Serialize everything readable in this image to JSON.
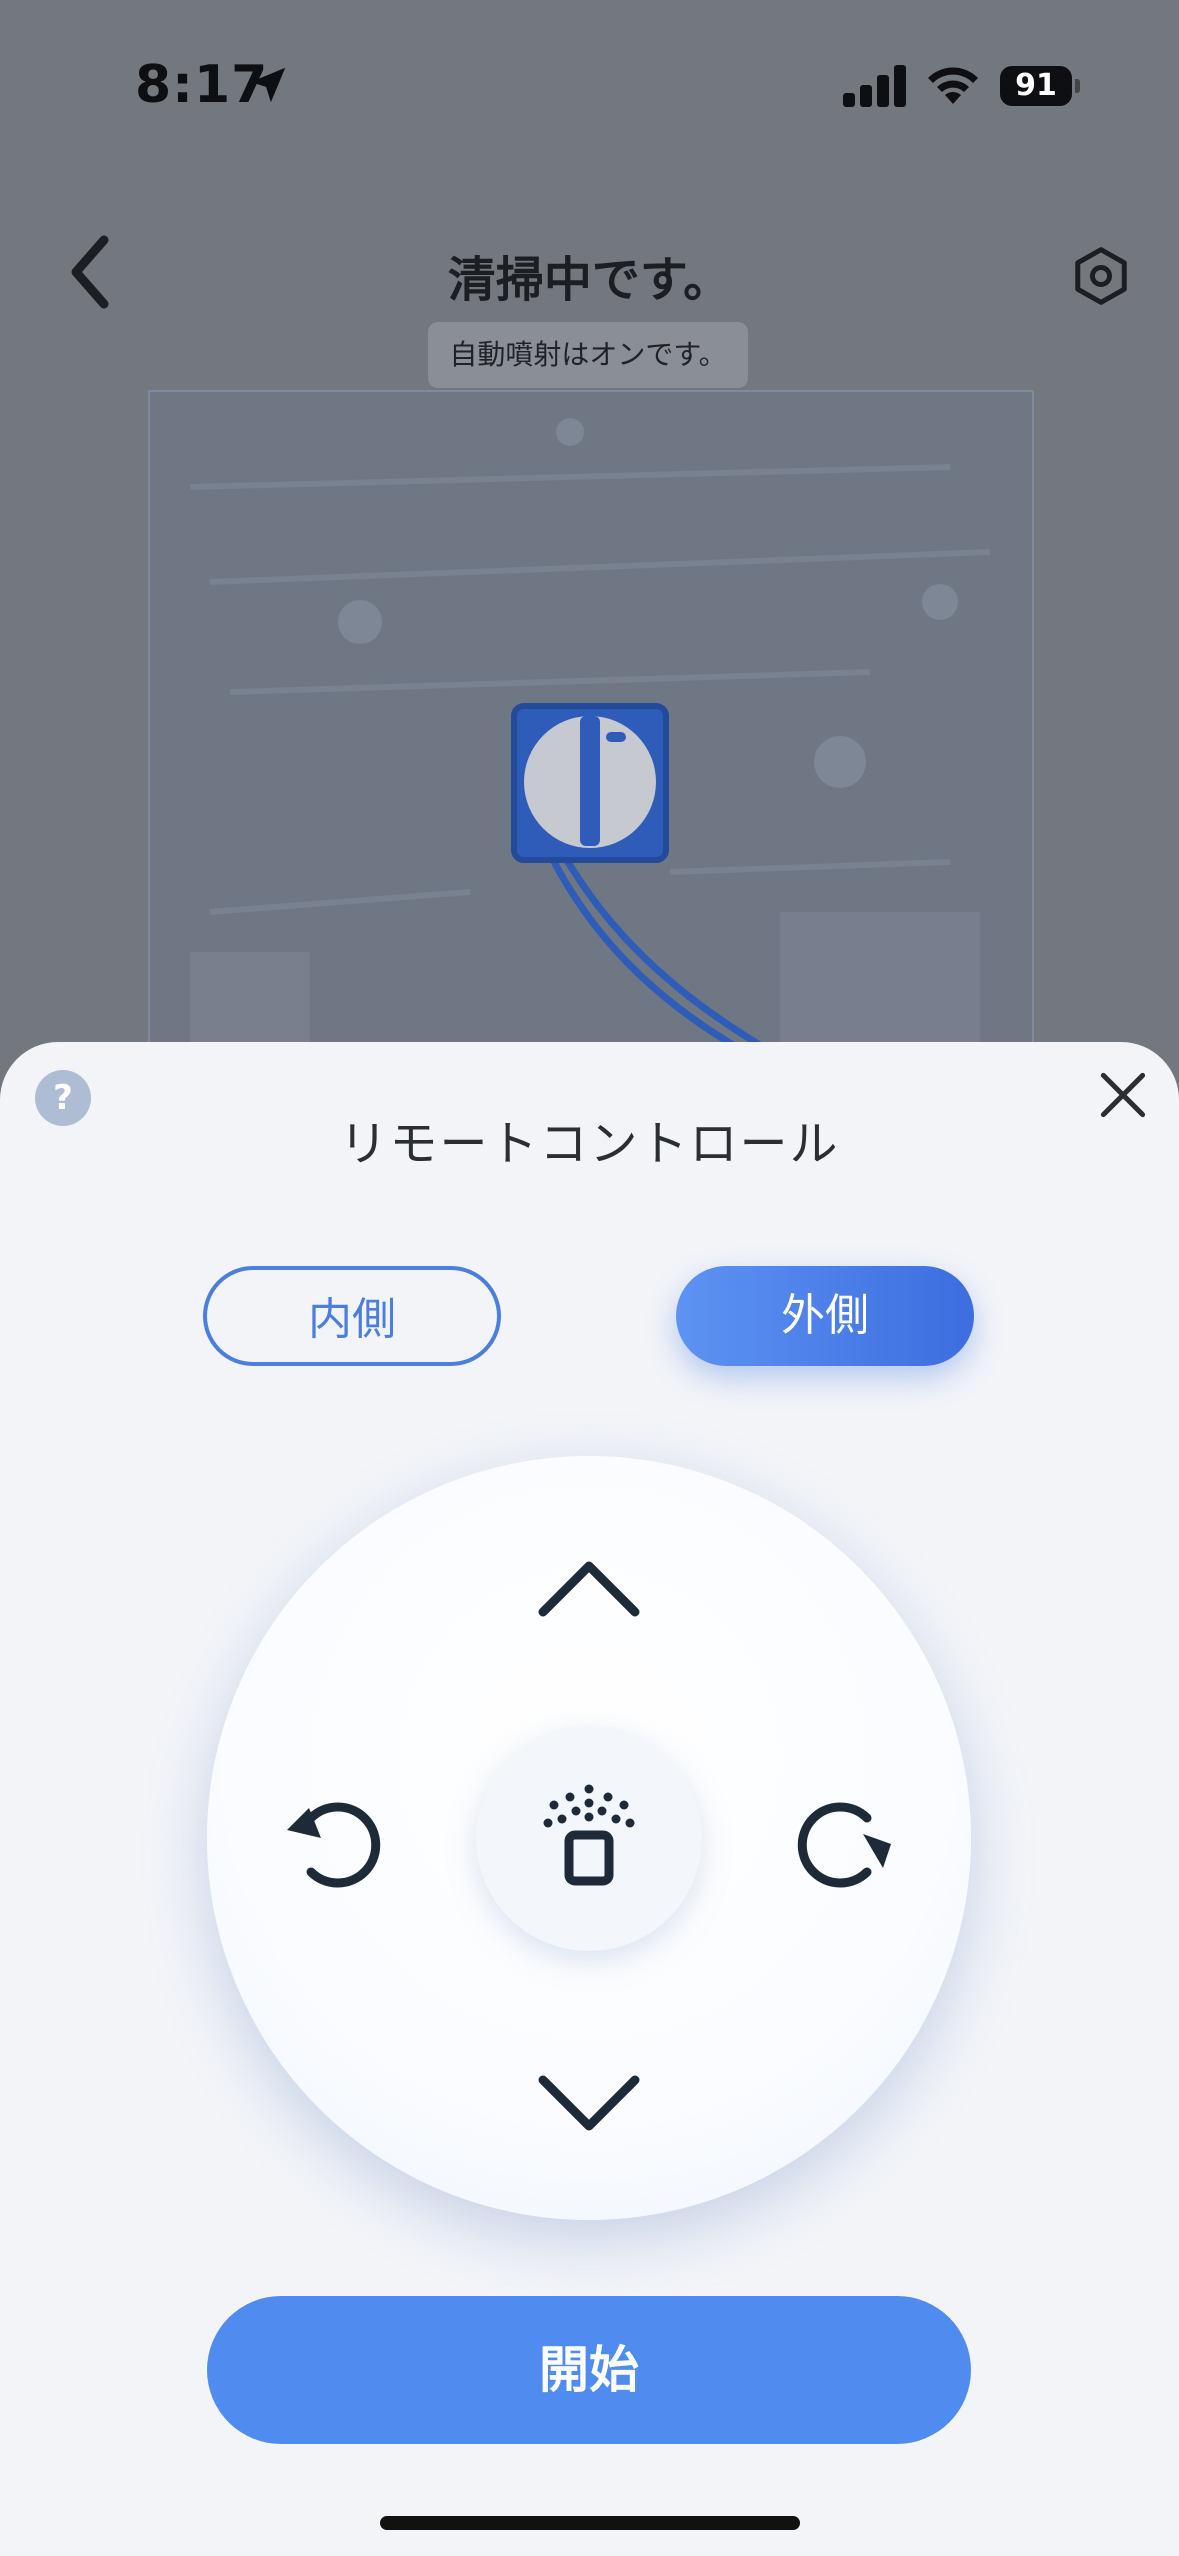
{
  "status_bar": {
    "time": "8:17",
    "battery": "91"
  },
  "header": {
    "title": "清掃中です。",
    "spray_status": "自動噴射はオンです。"
  },
  "sheet": {
    "title": "リモートコントロール",
    "help_label": "?",
    "modes": [
      {
        "label": "内側",
        "selected": false
      },
      {
        "label": "外側",
        "selected": true
      }
    ],
    "start_label": "開始"
  },
  "colors": {
    "accent": "#508cf0",
    "outline_accent": "#4a7fe0",
    "sheet_bg": "#f2f4f8",
    "icon_dark": "#1f2a38"
  },
  "icons": [
    "location-arrow-icon",
    "signal-icon",
    "wifi-icon",
    "battery-icon",
    "back-chevron-icon",
    "settings-hex-icon",
    "help-icon",
    "close-icon",
    "chevron-up-icon",
    "chevron-down-icon",
    "rotate-left-icon",
    "rotate-right-icon",
    "spray-icon"
  ]
}
